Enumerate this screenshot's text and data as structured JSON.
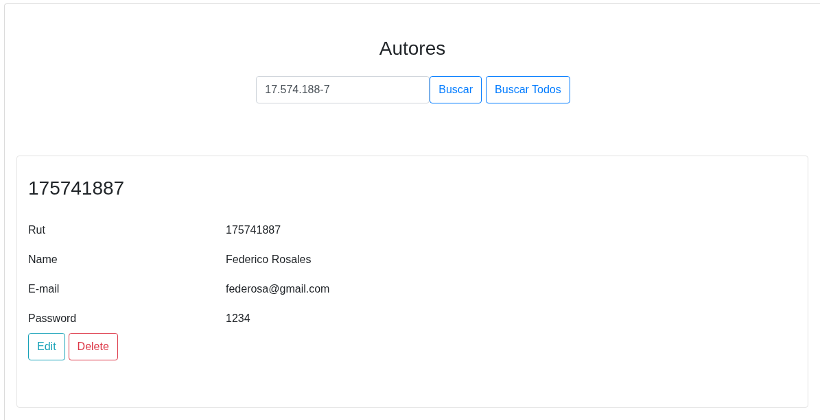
{
  "title": "Autores",
  "search": {
    "value": "17.574.188-7",
    "buttons": [
      {
        "label": "Buscar",
        "kind": "primary"
      },
      {
        "label": "Buscar Todos",
        "kind": "primary"
      }
    ]
  },
  "card": {
    "heading": "175741887",
    "fields": [
      {
        "label": "Rut",
        "value": "175741887"
      },
      {
        "label": "Name",
        "value": "Federico Rosales"
      },
      {
        "label": "E-mail",
        "value": "federosa@gmail.com"
      },
      {
        "label": "Password",
        "value": "1234"
      }
    ],
    "buttons": [
      {
        "label": "Edit",
        "kind": "info"
      },
      {
        "label": "Delete",
        "kind": "danger"
      }
    ]
  }
}
